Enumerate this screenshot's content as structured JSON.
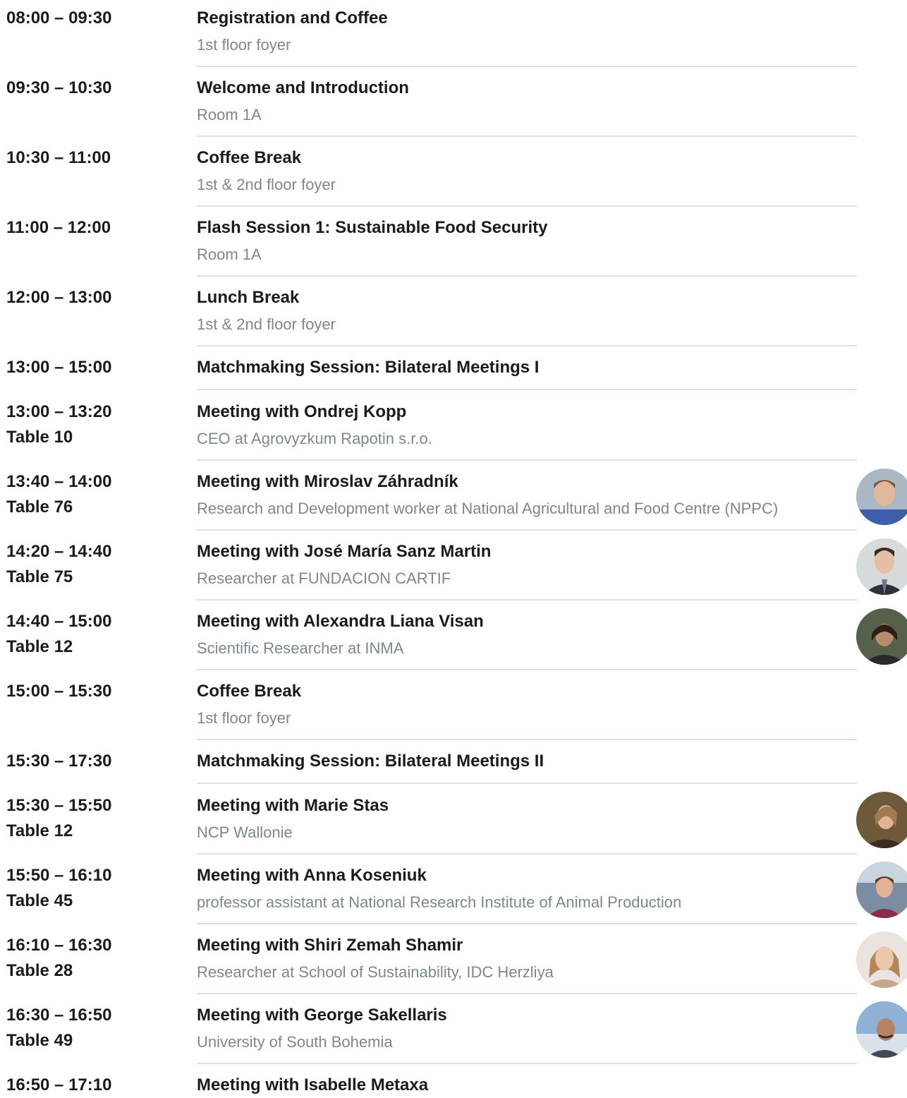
{
  "agenda": {
    "items": [
      {
        "time": "08:00 – 09:30",
        "table": "",
        "title": "Registration and Coffee",
        "subtitle": "1st floor foyer"
      },
      {
        "time": "09:30 – 10:30",
        "table": "",
        "title": "Welcome and Introduction",
        "subtitle": "Room 1A"
      },
      {
        "time": "10:30 – 11:00",
        "table": "",
        "title": "Coffee Break",
        "subtitle": "1st & 2nd floor foyer"
      },
      {
        "time": "11:00 – 12:00",
        "table": "",
        "title": "Flash Session 1: Sustainable Food Security",
        "subtitle": "Room 1A"
      },
      {
        "time": "12:00 – 13:00",
        "table": "",
        "title": "Lunch Break",
        "subtitle": "1st & 2nd floor foyer"
      },
      {
        "time": "13:00 – 15:00",
        "table": "",
        "title": "Matchmaking Session: Bilateral Meetings I",
        "subtitle": ""
      },
      {
        "time": "13:00 – 13:20",
        "table": "Table 10",
        "title": "Meeting with Ondrej Kopp",
        "subtitle": "CEO at Agrovyzkum Rapotin s.r.o."
      },
      {
        "time": "13:40 – 14:00",
        "table": "Table 76",
        "title": "Meeting with Miroslav Záhradník",
        "subtitle": "Research and Development worker at National Agricultural and Food Centre (NPPC)"
      },
      {
        "time": "14:20 – 14:40",
        "table": "Table 75",
        "title": "Meeting with José María Sanz Martin",
        "subtitle": "Researcher at FUNDACION CARTIF"
      },
      {
        "time": "14:40 – 15:00",
        "table": "Table 12",
        "title": "Meeting with Alexandra Liana Visan",
        "subtitle": "Scientific Researcher at INMA"
      },
      {
        "time": "15:00 – 15:30",
        "table": "",
        "title": "Coffee Break",
        "subtitle": "1st floor foyer"
      },
      {
        "time": "15:30 – 17:30",
        "table": "",
        "title": "Matchmaking Session: Bilateral Meetings II",
        "subtitle": ""
      },
      {
        "time": "15:30 – 15:50",
        "table": "Table 12",
        "title": "Meeting with Marie Stas",
        "subtitle": "NCP Wallonie"
      },
      {
        "time": "15:50 – 16:10",
        "table": "Table 45",
        "title": "Meeting with Anna Koseniuk",
        "subtitle": "professor assistant at National Research Institute of Animal Production"
      },
      {
        "time": "16:10 – 16:30",
        "table": "Table 28",
        "title": "Meeting with Shiri Zemah Shamir",
        "subtitle": "Researcher at School of Sustainability, IDC Herzliya"
      },
      {
        "time": "16:30 – 16:50",
        "table": "Table 49",
        "title": "Meeting with George Sakellaris",
        "subtitle": "University of South Bohemia"
      },
      {
        "time": "16:50 – 17:10",
        "table": "",
        "title": "Meeting with Isabelle Metaxa",
        "subtitle": ""
      }
    ]
  },
  "colors": {
    "text": "#1b1b1b",
    "subtitle": "#7d8790",
    "divider": "#dcdfe3"
  }
}
